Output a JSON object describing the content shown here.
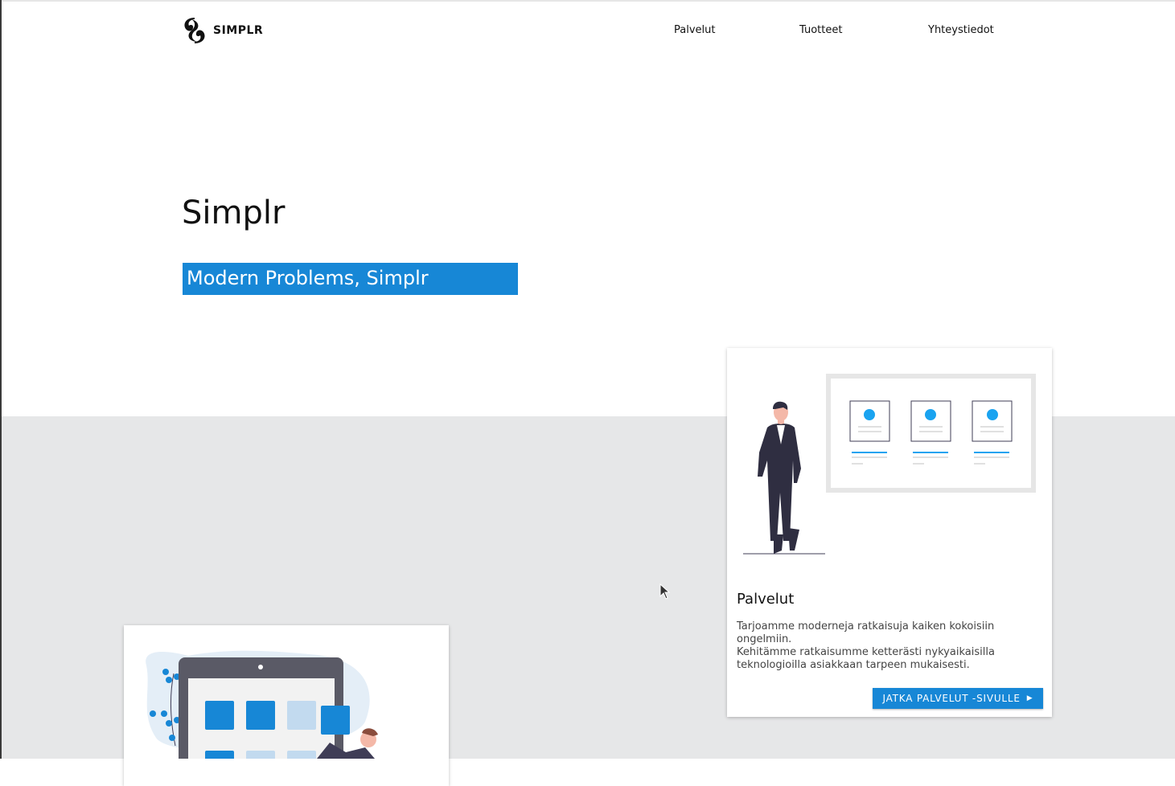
{
  "header": {
    "logo_text": "SIMPLR",
    "nav": [
      "Palvelut",
      "Tuotteet",
      "Yhteystiedot"
    ]
  },
  "hero": {
    "title": "Simplr",
    "tagline": "Modern Problems, Simplr Solutions"
  },
  "services_card": {
    "title": "Palvelut",
    "paragraph1": "Tarjoamme moderneja ratkaisuja kaiken kokoisiin ongelmiin.",
    "paragraph2": "Kehitämme ratkaisumme ketterästi nykyaikaisilla teknologioilla asiakkaan tarpeen mukaisesti.",
    "button_label": "JATKA PALVELUT -SIVULLE",
    "button_icon": "play-arrow-icon"
  },
  "colors": {
    "accent": "#1787d6",
    "section_bg": "#e6e7e8",
    "figure_dark": "#2f2e41"
  }
}
